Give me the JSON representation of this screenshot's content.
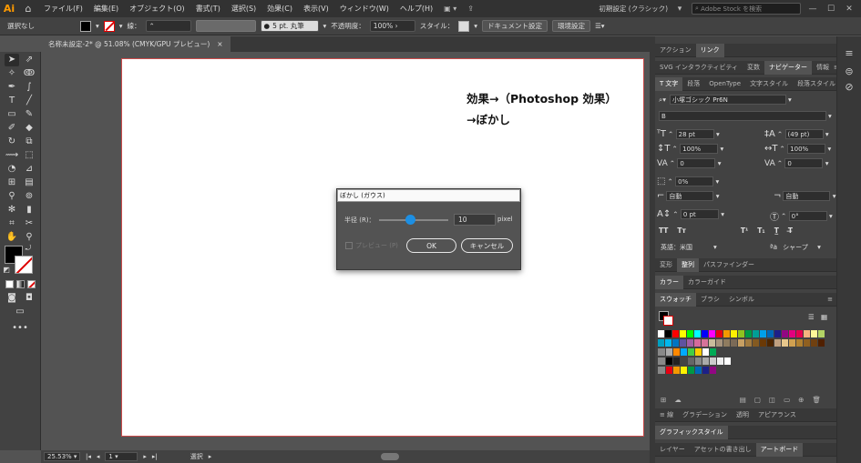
{
  "app": {
    "logo": "Ai",
    "home_icon": "home-icon"
  },
  "menu": [
    "ファイル(F)",
    "編集(E)",
    "オブジェクト(O)",
    "書式(T)",
    "選択(S)",
    "効果(C)",
    "表示(V)",
    "ウィンドウ(W)",
    "ヘルプ(H)"
  ],
  "menubar_right": {
    "workspace": "初期設定 (クラシック)",
    "stock_placeholder": "Adobe Stock を検索"
  },
  "control": {
    "selection": "選択なし",
    "stroke_label": "線：",
    "brush": "5 pt. 丸筆",
    "opacity_label": "不透明度：",
    "opacity": "100%",
    "style_label": "スタイル：",
    "doc_setup": "ドキュメント設定",
    "prefs": "環境設定"
  },
  "doc_tab": {
    "title": "名称未設定-2* @ 51.08% (CMYK/GPU プレビュー)",
    "close": "×"
  },
  "artboard_text": {
    "line1": "効果→（Photoshop 効果）",
    "line2": "→ぼかし"
  },
  "status": {
    "zoom": "25.53%",
    "artboard": "1",
    "tool": "選択"
  },
  "dialog": {
    "title": "ぼかし (ガウス)",
    "radius_label": "半径 (R)：",
    "radius_value": "10",
    "unit": "pixel",
    "radius_fraction": 0.45,
    "preview_label": "プレビュー (P)",
    "ok": "OK",
    "cancel": "キャンセル"
  },
  "panels": {
    "top_tabs": [
      "アクション",
      "リンク"
    ],
    "nav_tabs": [
      "SVG インタラクティビティ",
      "変数",
      "ナビゲーター",
      "情報"
    ],
    "char_tabs": [
      "文字",
      "段落",
      "OpenType",
      "文字スタイル",
      "段落スタイル"
    ],
    "font_name": "小塚ゴシック Pr6N",
    "font_style": "B",
    "size": "28 pt",
    "leading": "(49 pt)",
    "vscale": "100%",
    "hscale": "100%",
    "kerning": "0",
    "tracking": "0",
    "tsume": "0%",
    "aki1": "自動",
    "aki2": "自動",
    "baseline": "0 pt",
    "rotate": "0°",
    "tt1": "TT",
    "tt2": "Tт",
    "tt3": "T¹",
    "tt4": "T₁",
    "lang": "英語：米国",
    "aa": "シャープ",
    "transform_tabs": [
      "変形",
      "整列",
      "パスファインダー"
    ],
    "color_tabs": [
      "カラー",
      "カラーガイド"
    ],
    "swatch_tabs": [
      "スウォッチ",
      "ブラシ",
      "シンボル"
    ],
    "appearance_tabs": [
      "線",
      "グラデーション",
      "透明",
      "アピアランス"
    ],
    "graphic_styles": "グラフィックスタイル",
    "bottom_tabs": [
      "レイヤー",
      "アセットの書き出し",
      "アートボード"
    ]
  },
  "swatch_colors": [
    [
      "#ffffff",
      "#000000",
      "#ff0000",
      "#ffff00",
      "#00ff00",
      "#00ffff",
      "#0000ff",
      "#ff00ff",
      "#e60012",
      "#f39800",
      "#fff100",
      "#8fc31f",
      "#009944",
      "#009e96",
      "#00a0e9",
      "#0068b7",
      "#1d2088",
      "#920783",
      "#e4007f",
      "#e5004f",
      "#f6b37f",
      "#fff799",
      "#b3d465"
    ],
    [
      "#00a0c1",
      "#00b7ee",
      "#0075c2",
      "#5f52a0",
      "#a05ea4",
      "#d66a9c",
      "#d6739a",
      "#c9bc9c",
      "#a6937c",
      "#8f7c5f",
      "#7b6a57",
      "#c8a063",
      "#a27b3f",
      "#845a21",
      "#6a3906",
      "#4d2600",
      "#c0a080",
      "#e8c88c",
      "#d0a050",
      "#b08030",
      "#906020",
      "#704010",
      "#502000"
    ],
    [
      "#aaaaaa",
      "#ff8800",
      "#00aaff",
      "#44cc44",
      "#ffcc00",
      "#ffffff",
      "#00aa55"
    ],
    [
      "#000000",
      "#222222",
      "#444444",
      "#666666",
      "#888888",
      "#aaaaaa",
      "#cccccc",
      "#eeeeee",
      "#ffffff"
    ],
    [
      "#e60012",
      "#f39800",
      "#fff100",
      "#009944",
      "#0068b7",
      "#1d2088",
      "#920783"
    ]
  ]
}
